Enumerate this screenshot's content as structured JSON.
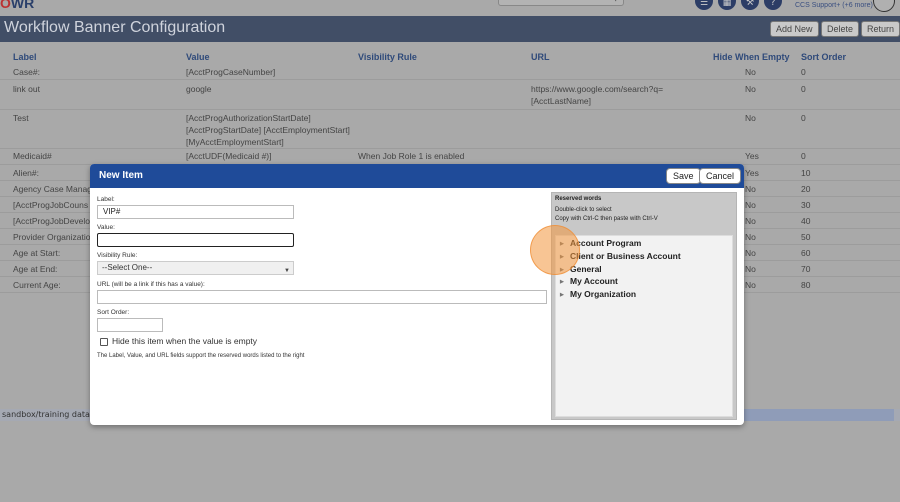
{
  "topbar": {
    "logo_prefix": "O",
    "logo_suffix": "WR",
    "support_text": "CCS Support+ (+6 more)"
  },
  "header": {
    "title": "Workflow Banner Configuration",
    "add_new_label": "Add New",
    "delete_label": "Delete",
    "return_label": "Return"
  },
  "table": {
    "headers": {
      "label": "Label",
      "value": "Value",
      "visibility_rule": "Visibility Rule",
      "url": "URL",
      "hide_when_empty": "Hide When Empty",
      "sort_order": "Sort Order"
    },
    "rows": [
      {
        "label": "Case#:",
        "value": "[AcctProgCaseNumber]",
        "rule": "",
        "url1": "",
        "url2": "",
        "hide": "No",
        "sort": "0"
      },
      {
        "label": "link out",
        "value": "google",
        "rule": "",
        "url1": "https://www.google.com/search?q=",
        "url2": "[AcctLastName]",
        "hide": "No",
        "sort": "0"
      },
      {
        "label": "Test",
        "value": "[AcctProgAuthorizationStartDate]",
        "value2": "[AcctProgStartDate] [AcctEmploymentStart]",
        "value3": "[MyAcctEmploymentStart]",
        "rule": "",
        "url1": "",
        "url2": "",
        "hide": "No",
        "sort": "0"
      },
      {
        "label": "Medicaid#",
        "value": "[AcctUDF(Medicaid #)]",
        "rule": "When Job Role 1 is enabled",
        "url1": "",
        "url2": "",
        "hide": "Yes",
        "sort": "0"
      },
      {
        "label": "Alien#:",
        "value": "",
        "rule": "",
        "url1": "",
        "url2": "",
        "hide": "Yes",
        "sort": "10"
      },
      {
        "label": "Agency Case Manag",
        "value": "",
        "rule": "",
        "url1": "",
        "url2": "",
        "hide": "No",
        "sort": "20"
      },
      {
        "label": "[AcctProgJobCouns",
        "value": "",
        "rule": "",
        "url1": "",
        "url2": "",
        "hide": "No",
        "sort": "30"
      },
      {
        "label": "[AcctProgJobDevelo",
        "value": "",
        "rule": "",
        "url1": "",
        "url2": "",
        "hide": "No",
        "sort": "40"
      },
      {
        "label": "Provider Organizatio",
        "value": "",
        "rule": "",
        "url1": "",
        "url2": "",
        "hide": "No",
        "sort": "50"
      },
      {
        "label": "Age at Start:",
        "value": "",
        "rule": "",
        "url1": "",
        "url2": "",
        "hide": "No",
        "sort": "60"
      },
      {
        "label": "Age at End:",
        "value": "",
        "rule": "",
        "url1": "",
        "url2": "",
        "hide": "No",
        "sort": "70"
      },
      {
        "label": "Current Age:",
        "value": "",
        "rule": "",
        "url1": "",
        "url2": "",
        "hide": "No",
        "sort": "80"
      }
    ]
  },
  "footer": {
    "sandbox_text": "sandbox/training datab"
  },
  "modal": {
    "title": "New Item",
    "save_label": "Save",
    "cancel_label": "Cancel",
    "label_field_label": "Label:",
    "label_value": "VIP#",
    "value_field_label": "Value:",
    "value_value": "",
    "visibility_field_label": "Visibility Rule:",
    "visibility_selected": "--Select One--",
    "url_field_label": "URL (will be a link if this has a value):",
    "url_value": "",
    "sort_field_label": "Sort Order:",
    "sort_value": "",
    "hide_checkbox_label": "Hide this item when the value is empty",
    "help_text": "The Label, Value, and URL fields support the reserved words listed to the right"
  },
  "reserved_words": {
    "title": "Reserved words",
    "line1": "Double-click to select",
    "line2": "Copy with Ctrl-C then paste with Ctrl-V",
    "items": [
      "Account Program",
      "Client or Business Account",
      "General",
      "My Account",
      "My Organization"
    ]
  },
  "colors": {
    "modal_header": "#1f4b99",
    "page_header": "#414e66",
    "cursor_highlight": "#f3963c"
  }
}
